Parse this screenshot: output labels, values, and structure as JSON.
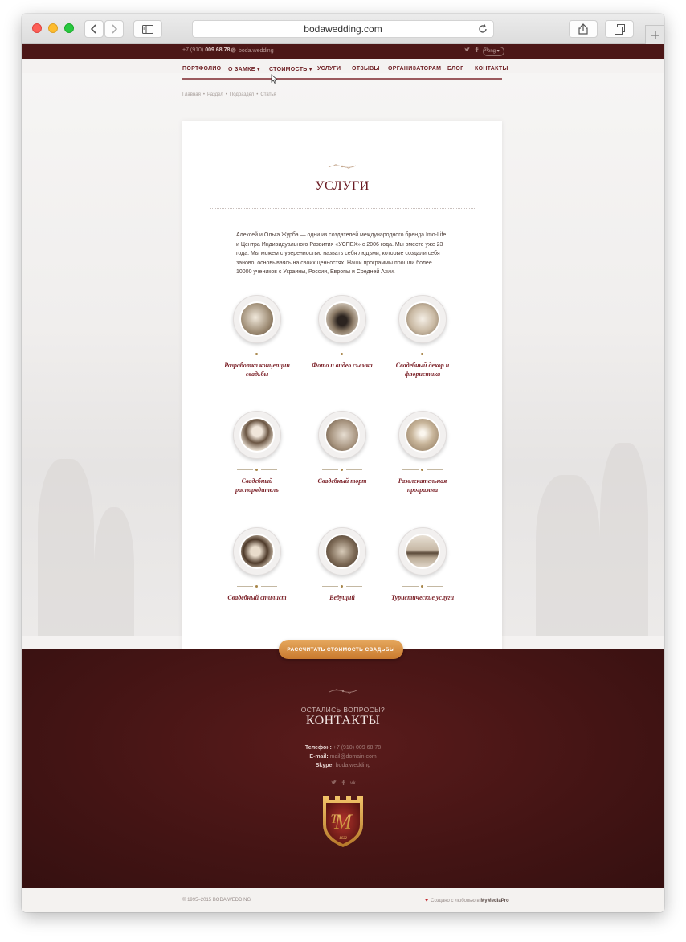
{
  "browser": {
    "url": "bodawedding.com"
  },
  "topbar": {
    "phone_prefix": "+7 (910) ",
    "phone_number": "009 68 78",
    "skype": "boda.wedding",
    "lang": "eng ▾"
  },
  "nav": {
    "items": [
      {
        "label": "ПОРТФОЛИО"
      },
      {
        "label": "О ЗАМКЕ ▾"
      },
      {
        "label": "СТОИМОСТЬ ▾"
      },
      {
        "label": "УСЛУГИ"
      },
      {
        "label": "ОТЗЫВЫ"
      },
      {
        "label": "ОРГАНИЗАТОРАМ"
      },
      {
        "label": "БЛОГ"
      },
      {
        "label": "КОНТАКТЫ"
      }
    ]
  },
  "breadcrumb": [
    "Главная",
    "Раздел",
    "Подраздел",
    "Статья"
  ],
  "card": {
    "title": "УСЛУГИ",
    "intro": "Алексей и Ольга Журба — одни из создателей международного бренда Imo-Life и Центра Индивидуального Развития «УСПЕХ» с 2006 года. Мы вместе уже 23 года. Мы можем с уверенностью назвать себя людьми, которые создали себя заново, основываясь на своих ценностях. Наши программы прошли более 10000 учеников с Украины, России, Европы и Средней Азии."
  },
  "services": [
    {
      "label": "Разработка концепции свадьбы"
    },
    {
      "label": "Фото и видео съемка"
    },
    {
      "label": "Свадебный декор и флористика"
    },
    {
      "label": "Свадебный распорядитель"
    },
    {
      "label": "Свадебный торт"
    },
    {
      "label": "Развлекательная программа"
    },
    {
      "label": "Свадебный стилист"
    },
    {
      "label": "Ведущий"
    },
    {
      "label": "Туристические услуги"
    }
  ],
  "cta": {
    "label": "РАССЧИТАТЬ СТОИМОСТЬ СВАДЬБЫ"
  },
  "footer": {
    "question": "ОСТАЛИСЬ ВОПРОСЫ?",
    "title": "КОНТАКТЫ",
    "phone_label": "Телефон:",
    "phone": "+7 (910) 009 68 78",
    "email_label": "E-mail:",
    "email": "mail@domain.com",
    "skype_label": "Skype:",
    "skype": "boda.wedding",
    "logo_year": "1632"
  },
  "bottom": {
    "copyright": "© 1995–2015 BODA WEDDING",
    "credit_prefix": "Создано с любовью в ",
    "credit_brand": "MyMediaPro"
  },
  "colors": {
    "brand_dark": "#4c1717",
    "accent_red": "#6e1f24",
    "cta_orange": "#d98d3f"
  }
}
